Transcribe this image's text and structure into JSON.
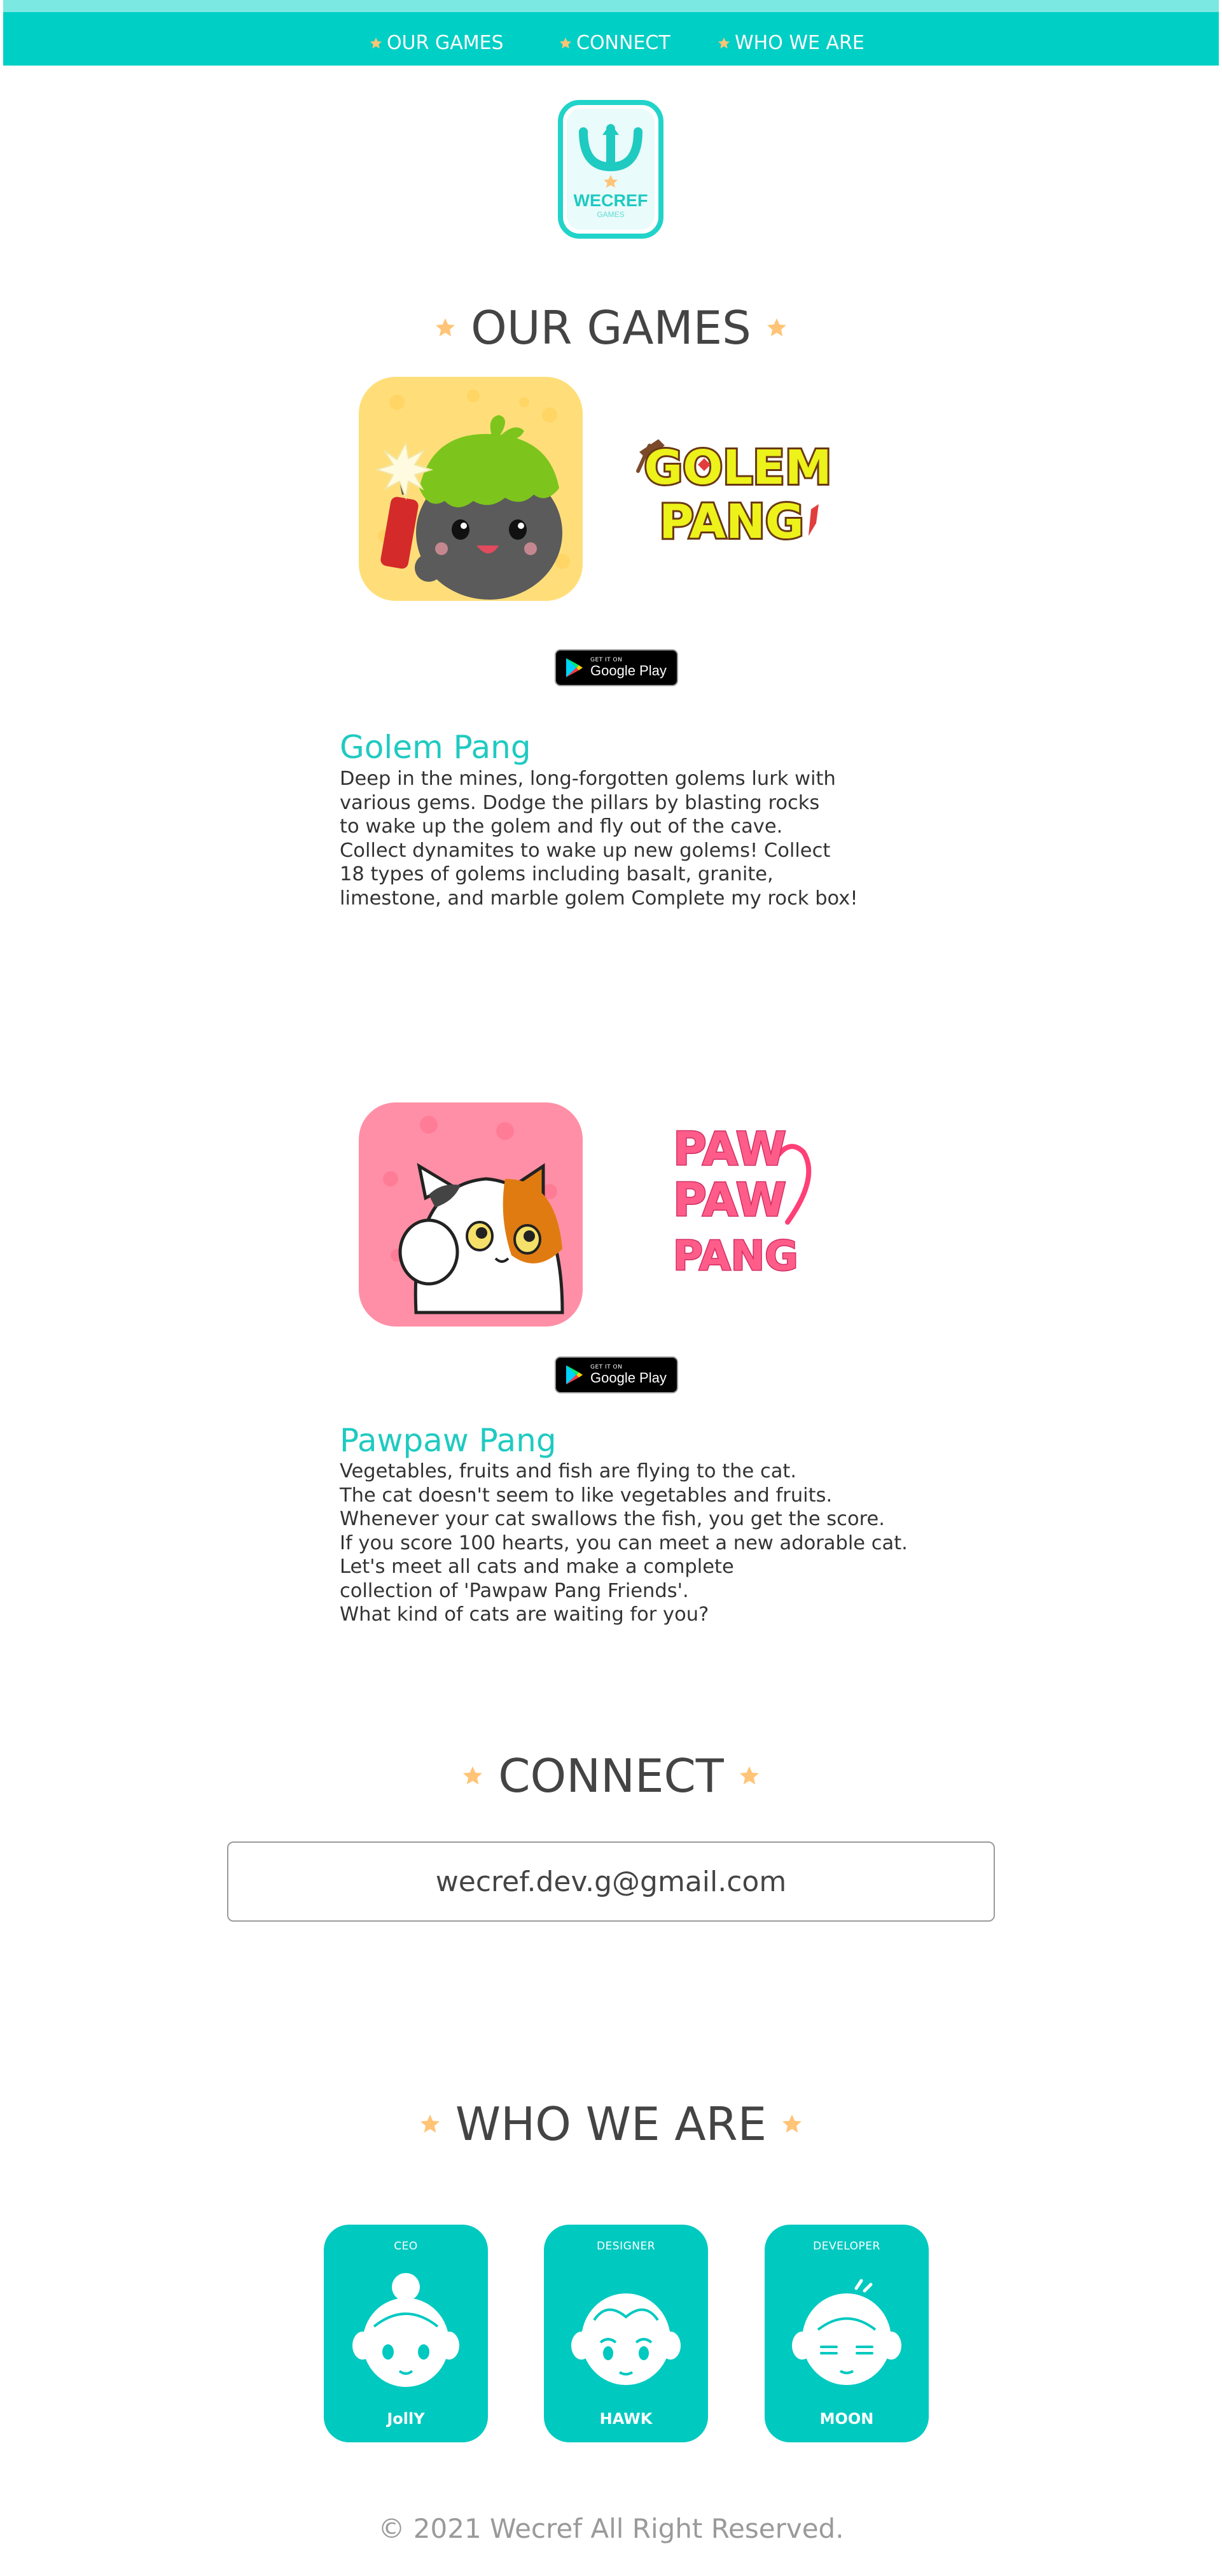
{
  "nav": {
    "items": [
      {
        "label": "OUR GAMES"
      },
      {
        "label": "CONNECT"
      },
      {
        "label": "WHO WE ARE"
      }
    ]
  },
  "logo": {
    "brand": "WECREF",
    "sub": "GAMES"
  },
  "sections": {
    "games_title": "OUR GAMES",
    "connect_title": "CONNECT",
    "who_title": "WHO WE ARE"
  },
  "games": [
    {
      "name": "Golem Pang",
      "title_art_lines": [
        "GOLEM",
        "PANG"
      ],
      "description": "Deep in the mines, long-forgotten golems lurk with\nvarious gems. Dodge the pillars by blasting rocks\nto wake up the golem and fly out of the cave.\nCollect dynamites to wake up new golems! Collect\n18 types of golems including basalt, granite,\nlimestone, and marble golem Complete my rock box!",
      "badge_small": "GET IT ON",
      "badge_big": "Google Play"
    },
    {
      "name": "Pawpaw Pang",
      "title_art_lines": [
        "PAW",
        "PAW",
        "PANG"
      ],
      "description": "Vegetables, fruits and fish are flying to the cat.\nThe cat doesn't seem to like vegetables and fruits.\nWhenever your cat swallows the fish, you get the score.\nIf you score 100 hearts, you can meet a new adorable cat.\nLet's meet all cats and make a complete\ncollection of 'Pawpaw Pang Friends'.\nWhat kind of cats are waiting for you?",
      "badge_small": "GET IT ON",
      "badge_big": "Google Play"
    }
  ],
  "connect": {
    "email": "wecref.dev.g@gmail.com"
  },
  "team": [
    {
      "role": "CEO",
      "name": "JollY"
    },
    {
      "role": "DESIGNER",
      "name": "HAWK"
    },
    {
      "role": "DEVELOPER",
      "name": "MOON"
    }
  ],
  "footer": {
    "text": "© 2021 Wecref All Right Reserved."
  },
  "colors": {
    "accent": "#00cfc5",
    "star": "#ffc477",
    "heading": "#444444",
    "game_name": "#1fcac1"
  }
}
